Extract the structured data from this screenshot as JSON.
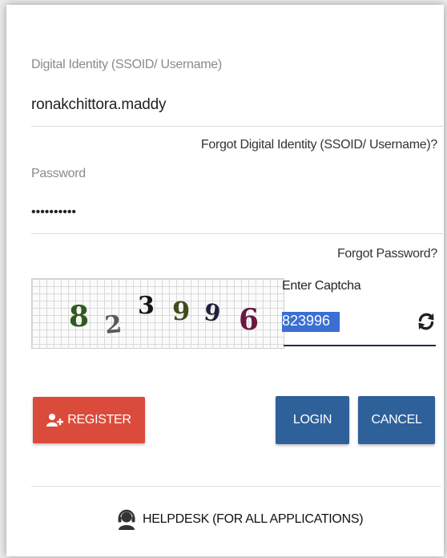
{
  "login_form": {
    "username_label": "Digital Identity (SSOID/ Username)",
    "username_value": "ronakchittora.maddy",
    "forgot_username_link": "Forgot Digital Identity (SSOID/ Username)?",
    "password_label": "Password",
    "password_value": "••••••••••",
    "forgot_password_link": "Forgot Password?",
    "captcha": {
      "digits": [
        "8",
        "2",
        "3",
        "9",
        "9",
        "6"
      ],
      "label": "Enter Captcha",
      "input_value": "823996",
      "refresh_icon": "refresh-icon"
    },
    "buttons": {
      "register": "REGISTER",
      "login": "LOGIN",
      "cancel": "CANCEL"
    },
    "helpdesk_label": "HELPDESK (FOR ALL APPLICATIONS)"
  },
  "colors": {
    "register": "#db4b3b",
    "primary": "#2e609a",
    "selection": "#3a6fd3"
  }
}
